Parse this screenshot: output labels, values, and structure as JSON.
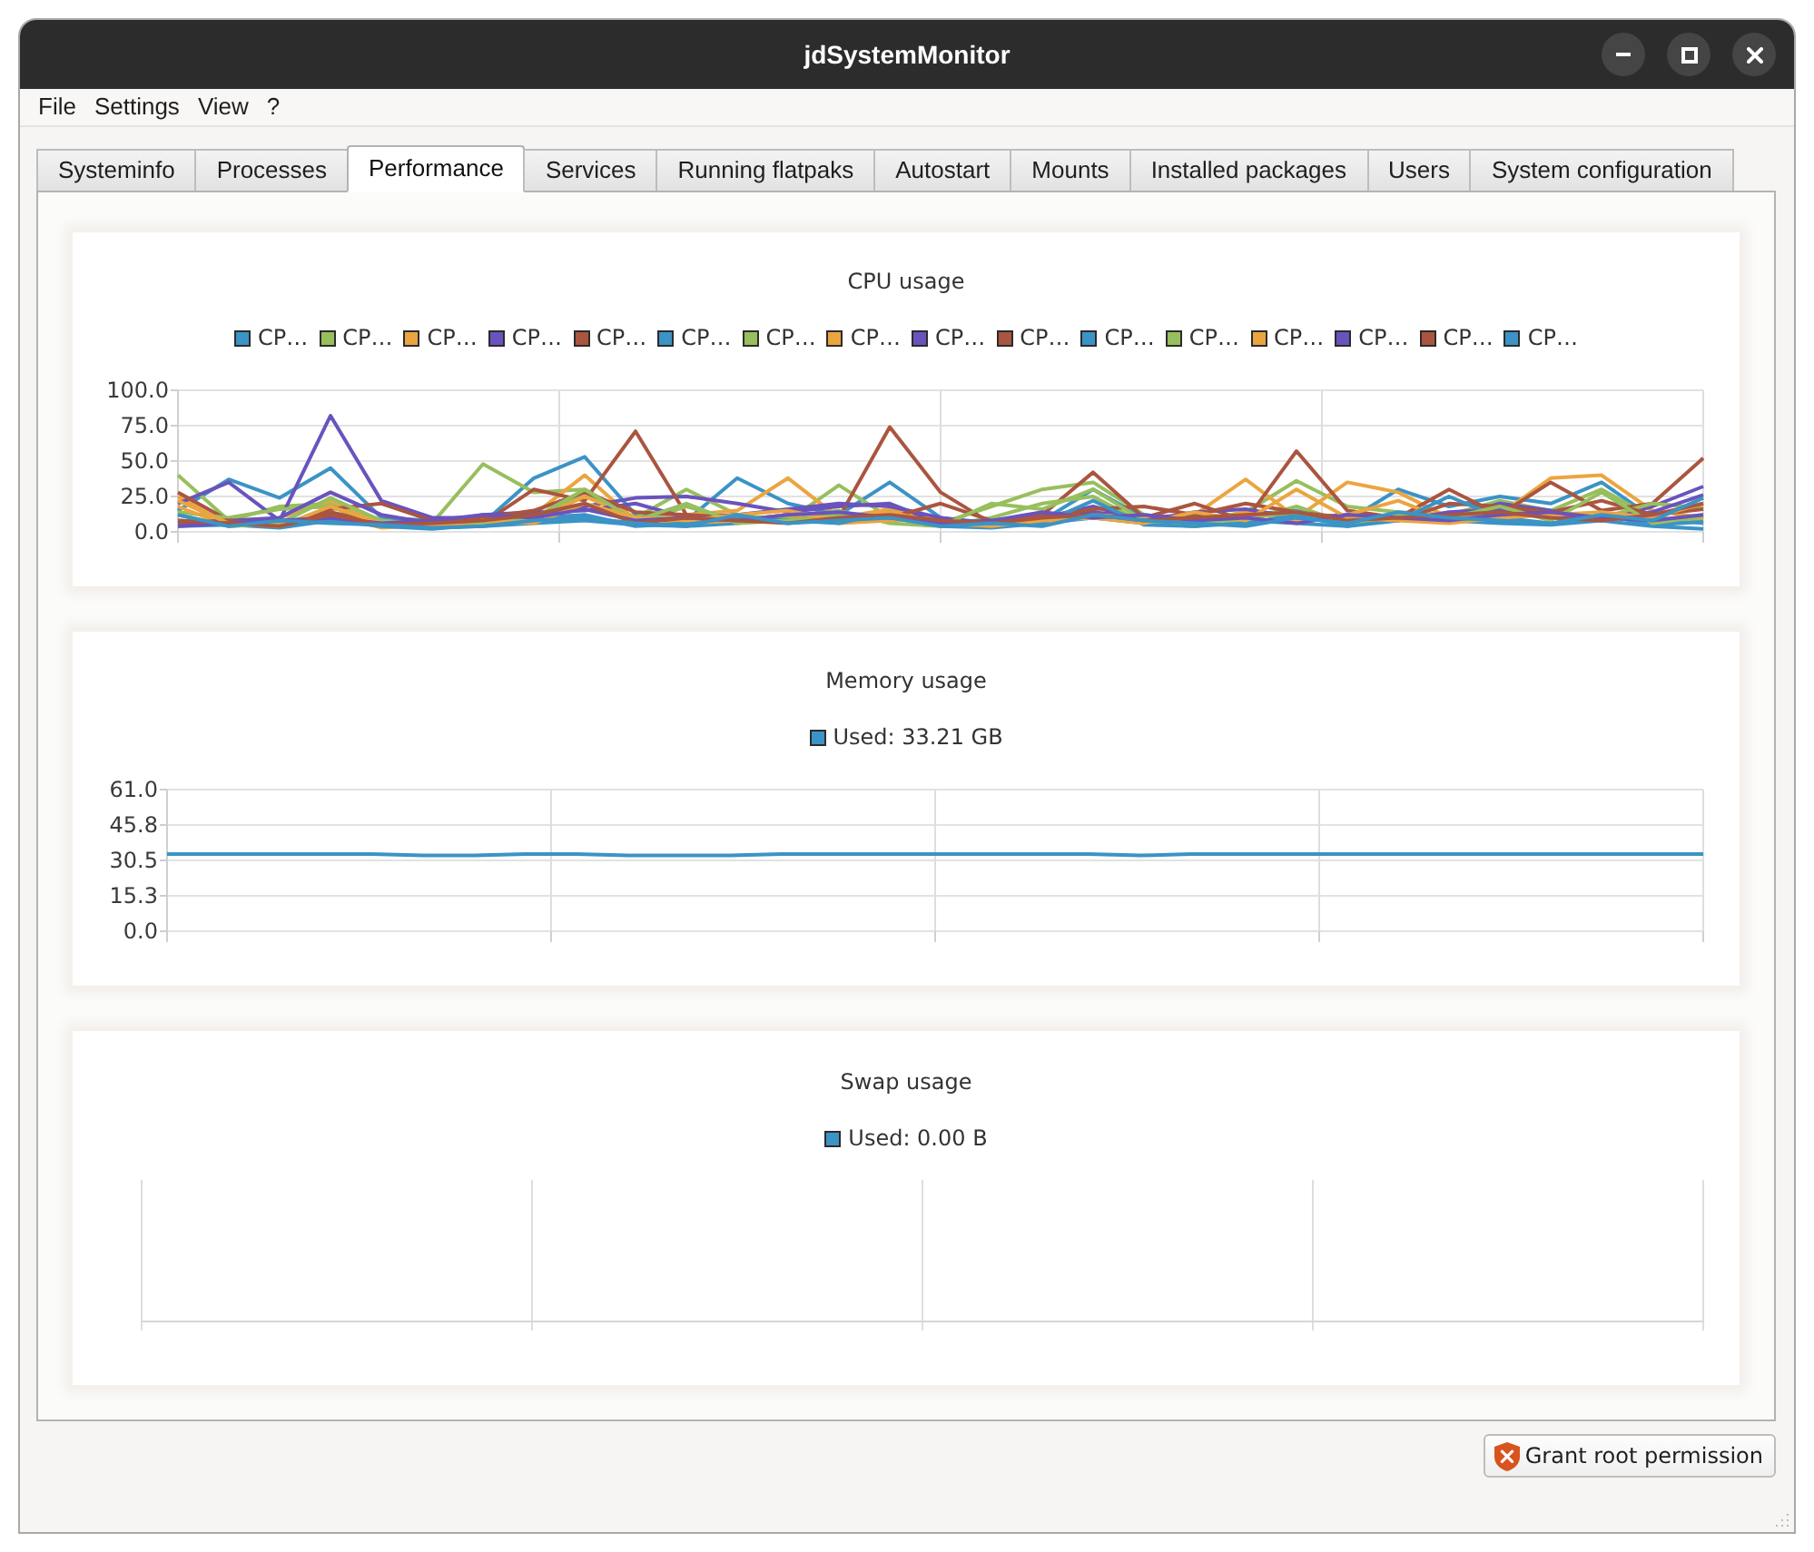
{
  "window": {
    "title": "jdSystemMonitor"
  },
  "menu": [
    "File",
    "Settings",
    "View",
    "?"
  ],
  "tabs": [
    {
      "label": "Systeminfo",
      "selected": false
    },
    {
      "label": "Processes",
      "selected": false
    },
    {
      "label": "Performance",
      "selected": true
    },
    {
      "label": "Services",
      "selected": false
    },
    {
      "label": "Running flatpaks",
      "selected": false
    },
    {
      "label": "Autostart",
      "selected": false
    },
    {
      "label": "Mounts",
      "selected": false
    },
    {
      "label": "Installed packages",
      "selected": false
    },
    {
      "label": "Users",
      "selected": false
    },
    {
      "label": "System configuration",
      "selected": false
    }
  ],
  "cpu_chart": {
    "chart_data": {
      "type": "line",
      "title": "CPU usage",
      "grid": true,
      "ylim": [
        0,
        100
      ],
      "yticks": [
        {
          "value": 0,
          "label": "0.0"
        },
        {
          "value": 25,
          "label": "25.0"
        },
        {
          "value": 50,
          "label": "50.0"
        },
        {
          "value": 75,
          "label": "75.0"
        },
        {
          "value": 100,
          "label": "100.0"
        }
      ],
      "series": [
        {
          "name": "CP…",
          "color": "#3b93c6",
          "values": [
            15,
            37,
            24,
            45,
            10,
            8,
            6,
            38,
            53,
            12,
            8,
            38,
            20,
            12,
            35,
            10,
            5,
            8,
            30,
            10,
            8,
            12,
            15,
            8,
            30,
            18,
            25,
            20,
            35,
            10,
            6
          ]
        },
        {
          "name": "CP…",
          "color": "#97bf5d",
          "values": [
            40,
            8,
            18,
            20,
            5,
            6,
            48,
            28,
            30,
            10,
            30,
            12,
            8,
            33,
            10,
            6,
            18,
            30,
            35,
            12,
            8,
            14,
            36,
            18,
            14,
            12,
            22,
            15,
            30,
            10,
            8
          ]
        },
        {
          "name": "CP…",
          "color": "#eba540",
          "values": [
            25,
            5,
            10,
            22,
            8,
            4,
            10,
            12,
            40,
            8,
            12,
            15,
            38,
            10,
            16,
            8,
            4,
            10,
            14,
            8,
            12,
            37,
            10,
            35,
            28,
            10,
            12,
            38,
            40,
            15,
            10
          ]
        },
        {
          "name": "CP…",
          "color": "#6a53bd",
          "values": [
            20,
            35,
            8,
            82,
            22,
            10,
            10,
            12,
            18,
            24,
            25,
            20,
            14,
            18,
            20,
            6,
            8,
            12,
            14,
            10,
            12,
            10,
            14,
            8,
            12,
            10,
            20,
            15,
            8,
            18,
            32
          ]
        },
        {
          "name": "CP…",
          "color": "#aa5540",
          "values": [
            28,
            8,
            4,
            16,
            20,
            8,
            6,
            30,
            22,
            71,
            12,
            8,
            12,
            10,
            74,
            28,
            6,
            12,
            42,
            10,
            20,
            8,
            57,
            15,
            10,
            30,
            12,
            35,
            15,
            20,
            52
          ]
        },
        {
          "name": "CP…",
          "color": "#3b93c6",
          "values": [
            8,
            6,
            4,
            10,
            5,
            3,
            4,
            6,
            8,
            5,
            4,
            6,
            10,
            8,
            12,
            5,
            4,
            6,
            10,
            6,
            4,
            8,
            6,
            4,
            10,
            8,
            6,
            5,
            8,
            4,
            2
          ]
        },
        {
          "name": "CP…",
          "color": "#97bf5d",
          "values": [
            14,
            10,
            16,
            18,
            4,
            6,
            10,
            8,
            28,
            6,
            18,
            8,
            10,
            15,
            6,
            4,
            10,
            20,
            25,
            6,
            4,
            8,
            18,
            6,
            10,
            8,
            15,
            12,
            10,
            20,
            17
          ]
        },
        {
          "name": "CP…",
          "color": "#eba540",
          "values": [
            18,
            4,
            6,
            12,
            3,
            5,
            6,
            8,
            25,
            10,
            6,
            8,
            12,
            6,
            8,
            10,
            4,
            6,
            12,
            10,
            6,
            14,
            8,
            12,
            22,
            8,
            10,
            14,
            10,
            8,
            12
          ]
        },
        {
          "name": "CP…",
          "color": "#6a53bd",
          "values": [
            6,
            8,
            10,
            28,
            12,
            6,
            12,
            14,
            15,
            20,
            10,
            12,
            16,
            20,
            18,
            10,
            6,
            10,
            18,
            8,
            14,
            16,
            10,
            12,
            8,
            14,
            16,
            12,
            10,
            14,
            26
          ]
        },
        {
          "name": "CP…",
          "color": "#aa5540",
          "values": [
            6,
            8,
            5,
            14,
            6,
            8,
            10,
            15,
            28,
            14,
            12,
            10,
            8,
            12,
            10,
            20,
            8,
            10,
            16,
            18,
            12,
            20,
            14,
            10,
            8,
            20,
            18,
            14,
            22,
            12,
            16
          ]
        },
        {
          "name": "CP…",
          "color": "#3b93c6",
          "values": [
            4,
            5,
            3,
            8,
            4,
            2,
            5,
            10,
            12,
            4,
            6,
            10,
            8,
            6,
            14,
            4,
            3,
            6,
            22,
            5,
            4,
            6,
            12,
            4,
            8,
            25,
            10,
            6,
            12,
            5,
            7
          ]
        },
        {
          "name": "CP…",
          "color": "#97bf5d",
          "values": [
            12,
            4,
            6,
            24,
            8,
            4,
            6,
            10,
            30,
            8,
            20,
            6,
            8,
            12,
            10,
            4,
            20,
            16,
            30,
            8,
            6,
            10,
            14,
            8,
            12,
            10,
            18,
            8,
            28,
            6,
            11
          ]
        },
        {
          "name": "CP…",
          "color": "#eba540",
          "values": [
            22,
            6,
            4,
            18,
            6,
            4,
            8,
            6,
            20,
            10,
            8,
            12,
            15,
            8,
            14,
            6,
            4,
            8,
            10,
            6,
            14,
            8,
            30,
            10,
            8,
            6,
            10,
            12,
            14,
            10,
            20
          ]
        },
        {
          "name": "CP…",
          "color": "#6a53bd",
          "values": [
            4,
            6,
            8,
            10,
            6,
            8,
            12,
            10,
            16,
            8,
            10,
            8,
            12,
            14,
            10,
            6,
            8,
            14,
            10,
            12,
            8,
            10,
            6,
            12,
            10,
            8,
            12,
            14,
            10,
            8,
            12
          ]
        },
        {
          "name": "CP…",
          "color": "#aa5540",
          "values": [
            8,
            6,
            4,
            12,
            5,
            6,
            8,
            12,
            20,
            6,
            10,
            8,
            6,
            10,
            12,
            8,
            6,
            10,
            12,
            8,
            10,
            12,
            14,
            8,
            10,
            12,
            14,
            10,
            8,
            12,
            20
          ]
        },
        {
          "name": "CP…",
          "color": "#3b93c6",
          "values": [
            12,
            4,
            8,
            6,
            5,
            3,
            4,
            8,
            10,
            6,
            4,
            12,
            6,
            8,
            10,
            4,
            6,
            4,
            12,
            8,
            6,
            4,
            10,
            6,
            14,
            10,
            8,
            6,
            12,
            8,
            24
          ]
        }
      ]
    }
  },
  "memory_chart": {
    "chart_data": {
      "type": "line",
      "title": "Memory usage",
      "grid": true,
      "ylim": [
        0,
        61
      ],
      "yticks": [
        {
          "value": 0,
          "label": "0.0"
        },
        {
          "value": 15.25,
          "label": "15.3"
        },
        {
          "value": 30.5,
          "label": "30.5"
        },
        {
          "value": 45.75,
          "label": "45.8"
        },
        {
          "value": 61,
          "label": "61.0"
        }
      ],
      "series": [
        {
          "name": "Used: 33.21 GB",
          "color": "#3b93c6",
          "values": [
            33.2,
            33.2,
            33.2,
            33.2,
            33.2,
            32.6,
            32.6,
            33.2,
            33.2,
            32.6,
            32.6,
            32.6,
            33.2,
            33.2,
            33.2,
            33.2,
            33.2,
            33.2,
            33.2,
            32.6,
            33.2,
            33.2,
            33.2,
            33.2,
            33.2,
            33.2,
            33.2,
            33.2,
            33.2,
            33.2,
            33.2
          ]
        }
      ]
    }
  },
  "swap_chart": {
    "title": "Swap usage",
    "legend": [
      {
        "label": "Used: 0.00 B",
        "color": "#3b93c6"
      }
    ]
  },
  "buttons": [
    {
      "label": "Grant root permission"
    }
  ]
}
